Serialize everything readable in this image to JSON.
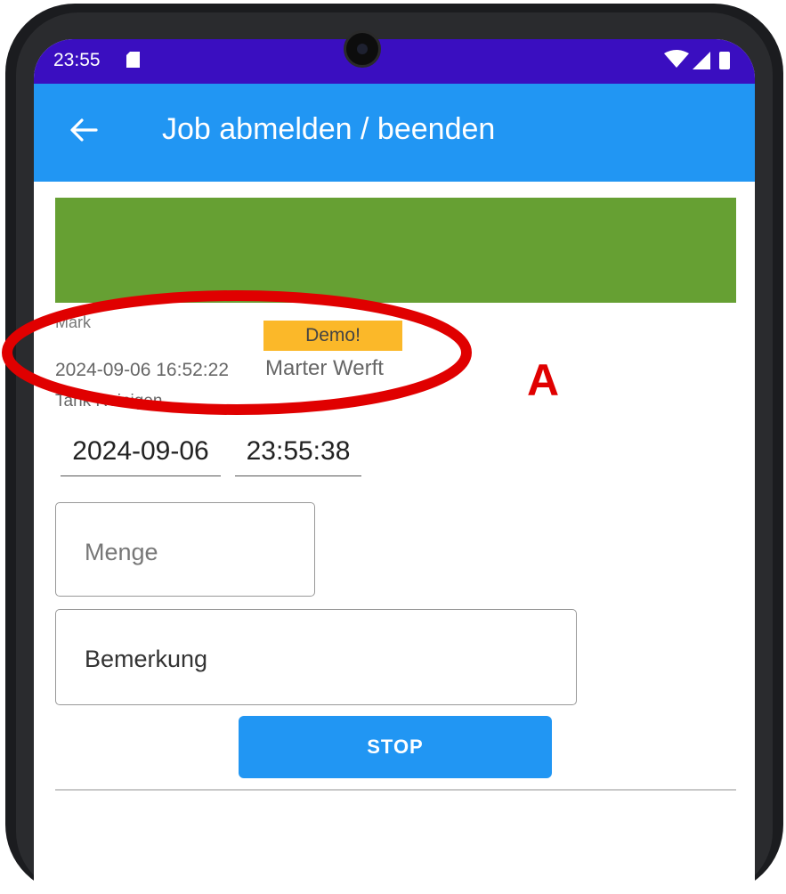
{
  "status_bar": {
    "time": "23:55",
    "icons": [
      "sd-card-icon",
      "wifi-icon",
      "signal-icon",
      "battery-icon"
    ]
  },
  "app_bar": {
    "back_icon": "arrow-back-icon",
    "title": "Job abmelden / beenden",
    "color": "#2196f3"
  },
  "banner": {
    "color": "#66a033"
  },
  "job": {
    "user": "Mark",
    "badge": "Demo!",
    "datetime": "2024-09-06 16:52:22",
    "location": "Marter Werft",
    "task": "Tank Reinigen"
  },
  "end_time": {
    "date": "2024-09-06",
    "time": "23:55:38"
  },
  "form": {
    "menge_placeholder": "Menge",
    "bemerkung_label": "Bemerkung",
    "stop_label": "STOP"
  },
  "annotation": {
    "label": "A",
    "color": "#e00000"
  }
}
